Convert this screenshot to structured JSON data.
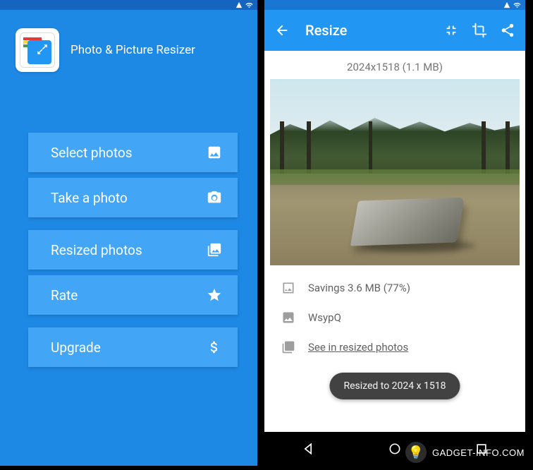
{
  "left": {
    "app_title": "Photo & Picture Resizer",
    "buttons": {
      "select": "Select photos",
      "take": "Take a photo",
      "resized": "Resized photos",
      "rate": "Rate",
      "upgrade": "Upgrade"
    }
  },
  "right": {
    "toolbar": {
      "title": "Resize"
    },
    "dim_label": "2024x1518 (1.1 MB)",
    "savings_row": "Savings 3.6 MB (77%)",
    "filename_row": "WsypQ",
    "see_link": "See in resized photos",
    "toast": "Resized to 2024 x 1518"
  },
  "watermark": "Gadget-Info.com"
}
